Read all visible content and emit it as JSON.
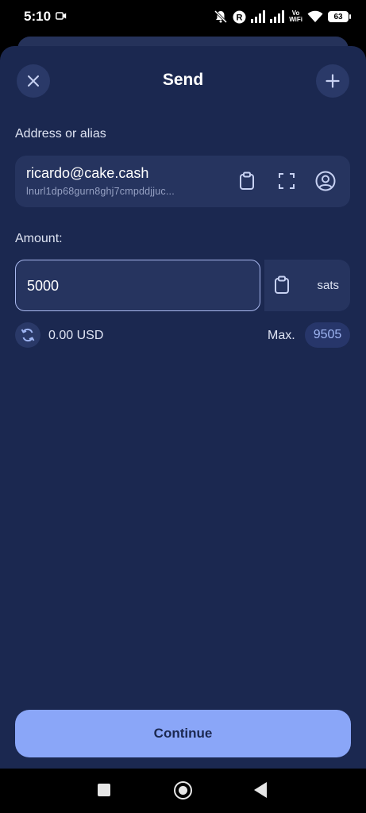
{
  "status_bar": {
    "time": "5:10",
    "volte": "Vo\nWiFi",
    "battery": "63",
    "r_badge": "R"
  },
  "sheet": {
    "title": "Send",
    "close_icon": "close-icon",
    "add_icon": "plus-icon"
  },
  "address": {
    "label": "Address or alias",
    "alias": "ricardo@cake.cash",
    "resolved": "lnurl1dp68gurn8ghj7cmpddjjuc...",
    "icons": [
      "clipboard-icon",
      "scan-qr-icon",
      "contact-icon"
    ]
  },
  "amount": {
    "label": "Amount:",
    "value": "5000",
    "unit": "sats",
    "fiat": "0.00 USD",
    "max_label": "Max.",
    "max_value": "9505"
  },
  "continue_label": "Continue",
  "colors": {
    "background": "#1b2850",
    "card": "#26345f",
    "accent": "#8aa6f8",
    "focus_border": "#a9b8ee"
  }
}
